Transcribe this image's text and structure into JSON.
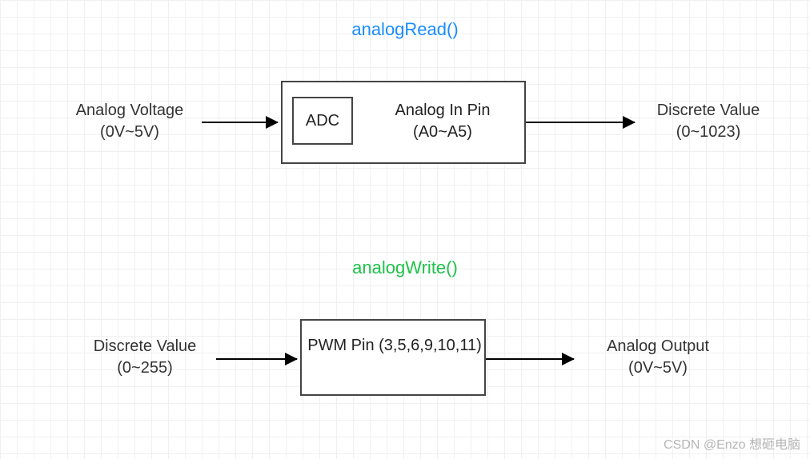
{
  "read": {
    "title": "analogRead()",
    "input": {
      "line1": "Analog Voltage",
      "line2": "(0V~5V)"
    },
    "box": {
      "adc": "ADC",
      "pin": {
        "line1": "Analog In Pin",
        "line2": "(A0~A5)"
      }
    },
    "output": {
      "line1": "Discrete Value",
      "line2": "(0~1023)"
    }
  },
  "write": {
    "title": "analogWrite()",
    "input": {
      "line1": "Discrete Value",
      "line2": "(0~255)"
    },
    "box": {
      "pin": {
        "line1": "PWM Pin",
        "line2": "(3,5,6,9,10,11)"
      }
    },
    "output": {
      "line1": "Analog Output",
      "line2": "(0V~5V)"
    }
  },
  "watermark": "CSDN @Enzo 想砸电脑"
}
